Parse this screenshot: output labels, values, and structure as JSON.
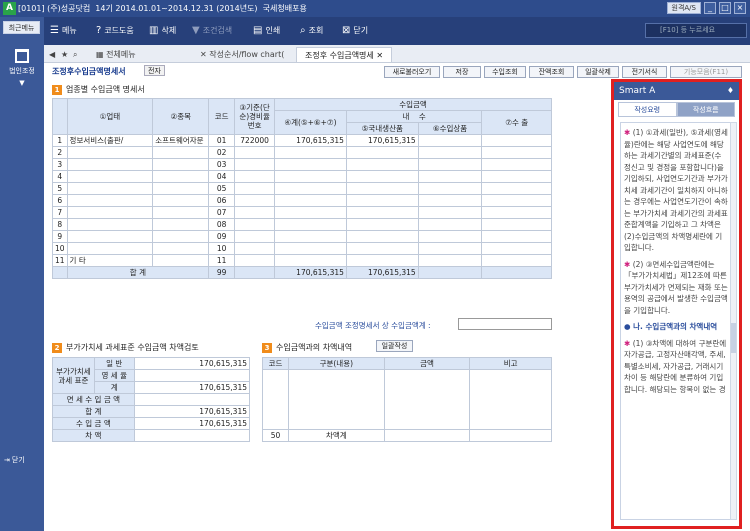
{
  "window": {
    "code": "[0101]",
    "company": "(주)성공닷컴",
    "period": "14기 2014.01.01~2014.12.31 (2014년도)",
    "menu_title": "국세청배포용",
    "remote_label": "원격A/S"
  },
  "leftbar": {
    "recent": "최근메뉴",
    "corp": "법인조정",
    "logout": "닫기"
  },
  "toolbar": {
    "menu": "메뉴",
    "code": "코드도움",
    "delete": "삭제",
    "cond": "조건검색",
    "print": "인쇄",
    "search": "조회",
    "close": "닫기",
    "search_placeholder": "[F10] 등 누르세요"
  },
  "tabs": [
    "전체메뉴",
    "작성순서/flow chart(",
    "조정후 수입금액명세"
  ],
  "crumb": {
    "title": "조정후수입금액명세서",
    "tag": "전자"
  },
  "actions": [
    "새로불러오기",
    "저장",
    "수입조회",
    "잔액조회",
    "일괄삭제",
    "전기서식",
    "기능모음(F11)"
  ],
  "section1": {
    "num": "1",
    "title": "업종별 수입금액 명세서",
    "headers": {
      "upte": "①업태",
      "jongmok": "②종목",
      "code": "코드",
      "gijun": "③기준(단순)경비율번호",
      "suip": "수입금액",
      "nae": "내",
      "su": "수",
      "total": "④계(⑤+⑥+⑦)",
      "domestic": "⑤국내생산품",
      "export_sale": "⑥수입상품",
      "export": "⑦수 출"
    },
    "rows": [
      {
        "n": "1",
        "upte": "정보서비스(출판/",
        "jongmok": "소프트웨어자문",
        "code": "01",
        "gijun": "722000",
        "total": "170,615,315",
        "dom": "170,615,315",
        "imp": "",
        "exp": ""
      },
      {
        "n": "2",
        "upte": "",
        "jongmok": "",
        "code": "02",
        "gijun": "",
        "total": "",
        "dom": "",
        "imp": "",
        "exp": ""
      },
      {
        "n": "3",
        "upte": "",
        "jongmok": "",
        "code": "03",
        "gijun": "",
        "total": "",
        "dom": "",
        "imp": "",
        "exp": ""
      },
      {
        "n": "4",
        "upte": "",
        "jongmok": "",
        "code": "04",
        "gijun": "",
        "total": "",
        "dom": "",
        "imp": "",
        "exp": ""
      },
      {
        "n": "5",
        "upte": "",
        "jongmok": "",
        "code": "05",
        "gijun": "",
        "total": "",
        "dom": "",
        "imp": "",
        "exp": ""
      },
      {
        "n": "6",
        "upte": "",
        "jongmok": "",
        "code": "06",
        "gijun": "",
        "total": "",
        "dom": "",
        "imp": "",
        "exp": ""
      },
      {
        "n": "7",
        "upte": "",
        "jongmok": "",
        "code": "07",
        "gijun": "",
        "total": "",
        "dom": "",
        "imp": "",
        "exp": ""
      },
      {
        "n": "8",
        "upte": "",
        "jongmok": "",
        "code": "08",
        "gijun": "",
        "total": "",
        "dom": "",
        "imp": "",
        "exp": ""
      },
      {
        "n": "9",
        "upte": "",
        "jongmok": "",
        "code": "09",
        "gijun": "",
        "total": "",
        "dom": "",
        "imp": "",
        "exp": ""
      },
      {
        "n": "10",
        "upte": "",
        "jongmok": "",
        "code": "10",
        "gijun": "",
        "total": "",
        "dom": "",
        "imp": "",
        "exp": ""
      },
      {
        "n": "11",
        "upte": "기    타",
        "jongmok": "",
        "code": "11",
        "gijun": "",
        "total": "",
        "dom": "",
        "imp": "",
        "exp": ""
      }
    ],
    "sum": {
      "label": "합 계",
      "code": "99",
      "total": "170,615,315",
      "dom": "170,615,315"
    },
    "note_label": "수입금액 조정명세서 상 수입금액계 :",
    "note_value": ""
  },
  "section2": {
    "num": "2",
    "title": "부가가치세 과세표준 수입금액 차액검토",
    "rows": [
      {
        "l1": "부가가치세 과세 표준",
        "l2": "일      반",
        "v": "170,615,315"
      },
      {
        "l1": "",
        "l2": "영  세  율",
        "v": ""
      },
      {
        "l1": "",
        "l2": "계",
        "v": "170,615,315"
      },
      {
        "l1": "면 세 수 입 금 액",
        "l2": "",
        "v": ""
      },
      {
        "l1": "합              계",
        "l2": "",
        "v": "170,615,315"
      },
      {
        "l1": "수   입   금   액",
        "l2": "",
        "v": "170,615,315"
      },
      {
        "l1": "차              액",
        "l2": "",
        "v": ""
      }
    ]
  },
  "section3": {
    "num": "3",
    "title": "수입금액과의 차액내역",
    "button": "일괄작성",
    "headers": [
      "코드",
      "구분(내용)",
      "금액",
      "비고"
    ],
    "foot_code": "50",
    "foot_label": "차액계"
  },
  "smart": {
    "title": "Smart A",
    "tab_on": "작성요령",
    "tab_off": "작성흐름",
    "p1": "(1) ①과세(일반), ⑤과세(영세율)란에는 해당 사업연도에 해당하는 과세기간별의 과세표준(수정신고 및 경정을 포함합니다)을 기입하되, 사업연도기간과 부가가치세 과세기간이 일치하지 아니하는 경우에는 사업연도기간이 속하는 부가가치세 과세기간의 과세표준합계액을 기입하고 그 차액은 (2)수입금액의 차액명세란에 기입합니다.",
    "p2": "(2) ③면세수입금액란에는 「부가가치세법」제12조에 따른 부가가치세가 면제되는 재화 또는 용역의 공급에서 발생한 수입금액을 기입합니다.",
    "h3": "나. 수입금액과의 차액내역",
    "p3": "(1) ③차액에 대하여 구분란에 자가공급, 고정자산매각액, 주세,특별소비세, 자가공급, 거래시기차이 등 해당란에 분류하여 기입합니다. 해당되는 항목이 없는 경"
  }
}
